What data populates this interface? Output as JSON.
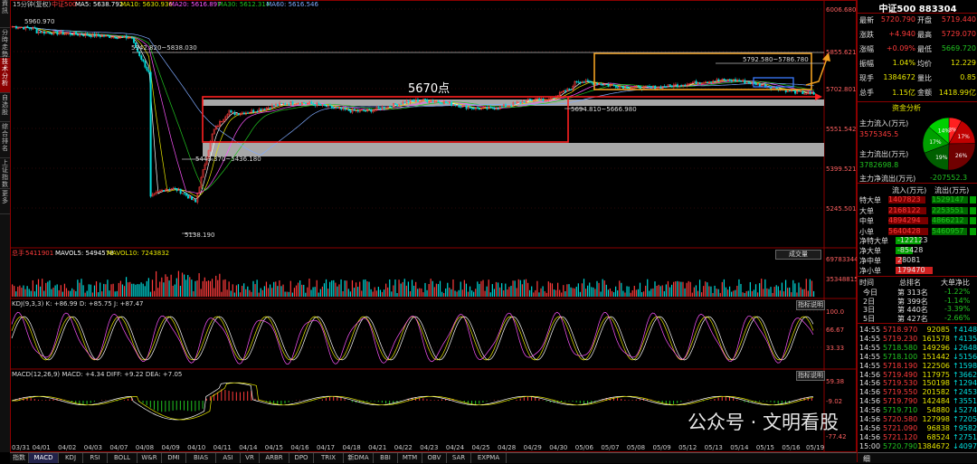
{
  "leftbar": {
    "items": [
      "資訊",
      "分時走勢",
      "技术分析",
      "自选股",
      "综合排名",
      "上证指数",
      "更多"
    ],
    "active": 2
  },
  "header": {
    "period_label": "15分钟(复权)",
    "code_label": "中证500",
    "ma": [
      {
        "label": "MA5: 5638.792",
        "color": "#ffffff"
      },
      {
        "label": "MA10: 5630.936",
        "color": "#e8e800"
      },
      {
        "label": "MA20: 5616.897",
        "color": "#ff55ff"
      },
      {
        "label": "MA30: 5612.314",
        "color": "#21c421"
      },
      {
        "label": "MA60: 5616.546",
        "color": "#7faaff"
      }
    ]
  },
  "price_axis": {
    "ticks": [
      "6006.680",
      "5855.621",
      "5702.801",
      "5551.542",
      "5399.521",
      "5245.501"
    ]
  },
  "volume_axis": {
    "ticks": [
      "69783344",
      "35348815"
    ]
  },
  "kdj_axis": {
    "ticks": [
      "100.0",
      "66.67",
      "33.33"
    ]
  },
  "macd_axis": {
    "ticks": [
      "59.38",
      "-9.02",
      "-77.42"
    ]
  },
  "annotations": {
    "high": "5960.970",
    "left_high": "5942.820~5838.030",
    "low_zone": "5443.370~5436.180",
    "low": "5138.190",
    "box_label": "5670点",
    "mid_range": "5694.810~5666.980",
    "upper_range": "5792.580~5786.780"
  },
  "volume_header": {
    "label": "总手",
    "value": "5411901",
    "mavol5": "MAVOL5: 5494578",
    "mavol10": "MAVOL10: 7243832"
  },
  "kdj_header": {
    "text": "KDJ(9,3,3) K: +86.99  D: +85.75  J: +87.47"
  },
  "macd_header": {
    "text": "MACD(12,26,9) MACD: +4.34  DIFF: +9.22  DEA: +7.05"
  },
  "buttons": {
    "volume": "成交量",
    "kdj": "指标说明",
    "macd": "指标说明"
  },
  "x_dates": [
    "03/31",
    "04/01",
    "04/02",
    "04/03",
    "04/07",
    "04/08",
    "04/09",
    "04/10",
    "04/11",
    "04/14",
    "04/15",
    "04/16",
    "04/17",
    "04/18",
    "04/21",
    "04/22",
    "04/23",
    "04/24",
    "04/25",
    "04/28",
    "04/29",
    "04/30",
    "05/06",
    "05/07",
    "05/08",
    "05/09",
    "05/12",
    "05/13",
    "05/14",
    "05/15",
    "05/16",
    "05/19"
  ],
  "tabs": [
    "指数",
    "MACD",
    "KDJ",
    "RSI",
    "BOLL",
    "W&R",
    "DMI",
    "BIAS",
    "ASI",
    "VR",
    "ARBR",
    "DPO",
    "TRIX",
    "新DMA",
    "BBI",
    "MTM",
    "OBV",
    "SAR",
    "EXPMA"
  ],
  "tabs_active": 1,
  "right_panel": {
    "title": "中证500 883304",
    "quote_rows": [
      {
        "l1": "最新",
        "v1": "5720.790",
        "c1": "red",
        "l2": "开盘",
        "v2": "5719.440",
        "c2": "red"
      },
      {
        "l1": "涨跌",
        "v1": "+4.940",
        "c1": "red",
        "l2": "最高",
        "v2": "5729.070",
        "c2": "red"
      },
      {
        "l1": "涨幅",
        "v1": "+0.09%",
        "c1": "red",
        "l2": "最低",
        "v2": "5669.720",
        "c2": "green"
      },
      {
        "l1": "振幅",
        "v1": "1.04%",
        "c1": "yellow",
        "l2": "均价",
        "v2": "12.229",
        "c2": "yellow"
      },
      {
        "l1": "现手",
        "v1": "1384672",
        "c1": "yellow",
        "l2": "量比",
        "v2": "0.85",
        "c2": "yellow"
      },
      {
        "l1": "总手",
        "v1": "1.15亿",
        "c1": "yellow",
        "l2": "金额",
        "v2": "1418.99亿",
        "c2": "yellow"
      }
    ],
    "fund_title": "资金分析",
    "inflow_label": "主力流入(万元)",
    "inflow_value": "3575345.5",
    "outflow_label": "主力流出(万元)",
    "outflow_value": "3782698.8",
    "net_label": "主力净流出(万元)",
    "net_value": "-207552.3",
    "pie": [
      {
        "label": "8%",
        "color": "#ff2020",
        "value": 8
      },
      {
        "label": "17%",
        "color": "#c00000",
        "value": 17
      },
      {
        "label": "26%",
        "color": "#700000",
        "value": 26
      },
      {
        "label": "19%",
        "color": "#006000",
        "value": 19
      },
      {
        "label": "17%",
        "color": "#00a000",
        "value": 17
      },
      {
        "label": "14%",
        "color": "#00d000",
        "value": 14
      }
    ],
    "flow_headers": [
      "流入(万元)",
      "流出(万元)"
    ],
    "flow_rows": [
      {
        "name": "特大单",
        "in": "1407823",
        "out": "1529147",
        "in_ratio": 0.92,
        "out_ratio": 1.0
      },
      {
        "name": "大单",
        "in": "2168122",
        "out": "2253551",
        "in_ratio": 0.96,
        "out_ratio": 1.0
      },
      {
        "name": "中单",
        "in": "4894294",
        "out": "4866212",
        "in_ratio": 1.0,
        "out_ratio": 0.99
      },
      {
        "name": "小单",
        "in": "5640428",
        "out": "5460957",
        "in_ratio": 1.0,
        "out_ratio": 0.97
      }
    ],
    "net_rows": [
      {
        "name": "净特大单",
        "value": "-122123",
        "ratio": 0.32,
        "color": "green"
      },
      {
        "name": "净大单",
        "value": "-85428",
        "ratio": 0.22,
        "color": "green"
      },
      {
        "name": "净中单",
        "value": "28081",
        "ratio": 0.08,
        "color": "red"
      },
      {
        "name": "净小单",
        "value": "179470",
        "ratio": 0.47,
        "color": "red"
      }
    ],
    "rank_headers": [
      "时间",
      "总排名",
      "大单净比"
    ],
    "rank_rows": [
      {
        "period": "今日",
        "rank": "第 313名",
        "ratio": "-1.22%"
      },
      {
        "period": "2日",
        "rank": "第 399名",
        "ratio": "-1.14%"
      },
      {
        "period": "3日",
        "rank": "第 440名",
        "ratio": "-3.39%"
      },
      {
        "period": "5日",
        "rank": "第 427名",
        "ratio": "-2.66%"
      }
    ],
    "ticks": [
      {
        "t": "14:55",
        "p": "5718.970",
        "v": "92085",
        "s": "4148",
        "c": "red"
      },
      {
        "t": "14:55",
        "p": "5719.230",
        "v": "161578",
        "s": "4135",
        "c": "red"
      },
      {
        "t": "14:55",
        "p": "5718.580",
        "v": "149296",
        "s": "2648",
        "c": "green"
      },
      {
        "t": "14:55",
        "p": "5718.100",
        "v": "151442",
        "s": "5156",
        "c": "green"
      },
      {
        "t": "14:55",
        "p": "5718.190",
        "v": "122506",
        "s": "1598",
        "c": "red"
      },
      {
        "t": "14:56",
        "p": "5719.490",
        "v": "117975",
        "s": "3662",
        "c": "red"
      },
      {
        "t": "14:56",
        "p": "5719.530",
        "v": "150198",
        "s": "1294",
        "c": "red"
      },
      {
        "t": "14:56",
        "p": "5719.550",
        "v": "201582",
        "s": "2453",
        "c": "red"
      },
      {
        "t": "14:56",
        "p": "5719.790",
        "v": "142484",
        "s": "3551",
        "c": "red"
      },
      {
        "t": "14:56",
        "p": "5719.710",
        "v": "54880",
        "s": "5274",
        "c": "green"
      },
      {
        "t": "14:56",
        "p": "5720.580",
        "v": "127998",
        "s": "7205",
        "c": "red"
      },
      {
        "t": "14:56",
        "p": "5721.090",
        "v": "96838",
        "s": "9582",
        "c": "red"
      },
      {
        "t": "14:56",
        "p": "5721.120",
        "v": "68524",
        "s": "2751",
        "c": "red"
      },
      {
        "t": "15:00",
        "p": "5720.790",
        "v": "1384672",
        "s": "4097",
        "c": "green"
      }
    ],
    "bottom_tab": "细"
  },
  "watermark": "公众号 · 文明看股"
}
